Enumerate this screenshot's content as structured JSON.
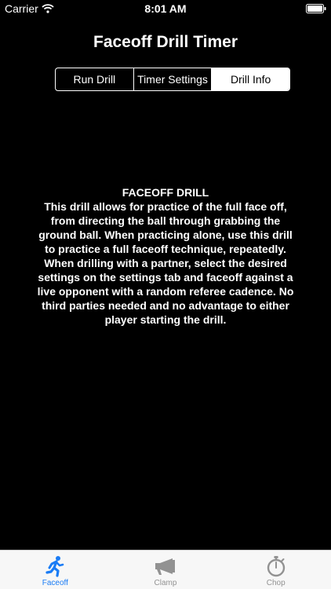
{
  "status_bar": {
    "carrier": "Carrier",
    "time": "8:01 AM"
  },
  "nav": {
    "title": "Faceoff Drill Timer"
  },
  "segments": [
    {
      "label": "Run Drill",
      "selected": false
    },
    {
      "label": "Timer Settings",
      "selected": false
    },
    {
      "label": "Drill Info",
      "selected": true
    }
  ],
  "info": {
    "heading": "FACEOFF DRILL",
    "body": "This drill allows for practice of the full face off, from directing the ball through grabbing the ground ball.  When practicing alone, use this drill to practice a full faceoff technique, repeatedly.  When drilling with a partner, select the desired settings on the settings tab and faceoff against a live opponent with a random referee cadence.  No third parties needed and no advantage to either player starting the drill."
  },
  "tabs": [
    {
      "label": "Faceoff",
      "icon": "running-person-icon",
      "active": true
    },
    {
      "label": "Clamp",
      "icon": "megaphone-icon",
      "active": false
    },
    {
      "label": "Chop",
      "icon": "stopwatch-icon",
      "active": false
    }
  ],
  "colors": {
    "background": "#000000",
    "tab_active": "#1a7cf5",
    "tab_inactive": "#929292",
    "tab_bar_bg": "#f7f7f7"
  }
}
